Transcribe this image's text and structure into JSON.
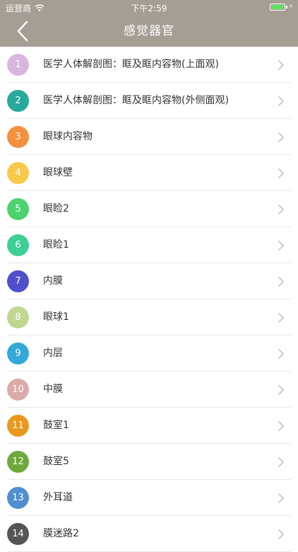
{
  "status_bar": {
    "carrier": "运营商",
    "time": "下午2:59"
  },
  "nav": {
    "title": "感觉器官"
  },
  "items": [
    {
      "number": "1",
      "label": "医学人体解剖图：眶及眶内容物(上面观)",
      "color": "#d9b6de"
    },
    {
      "number": "2",
      "label": "医学人体解剖图：眶及眶内容物(外侧面观)",
      "color": "#27a99b"
    },
    {
      "number": "3",
      "label": "眼球内容物",
      "color": "#f5913c"
    },
    {
      "number": "4",
      "label": "眼球壁",
      "color": "#f7c94a"
    },
    {
      "number": "5",
      "label": "眼睑2",
      "color": "#4cd36e"
    },
    {
      "number": "6",
      "label": "眼睑1",
      "color": "#3ecf95"
    },
    {
      "number": "7",
      "label": "内膜",
      "color": "#4e4fc9"
    },
    {
      "number": "8",
      "label": "眼球1",
      "color": "#c1d78f"
    },
    {
      "number": "9",
      "label": "内层",
      "color": "#32a9d9"
    },
    {
      "number": "10",
      "label": "中膜",
      "color": "#dcaaa8"
    },
    {
      "number": "11",
      "label": "鼓室1",
      "color": "#e8981e"
    },
    {
      "number": "12",
      "label": "鼓室5",
      "color": "#6fa93a"
    },
    {
      "number": "13",
      "label": "外耳道",
      "color": "#4f8fcf"
    },
    {
      "number": "14",
      "label": "膜迷路2",
      "color": "#555555"
    }
  ]
}
